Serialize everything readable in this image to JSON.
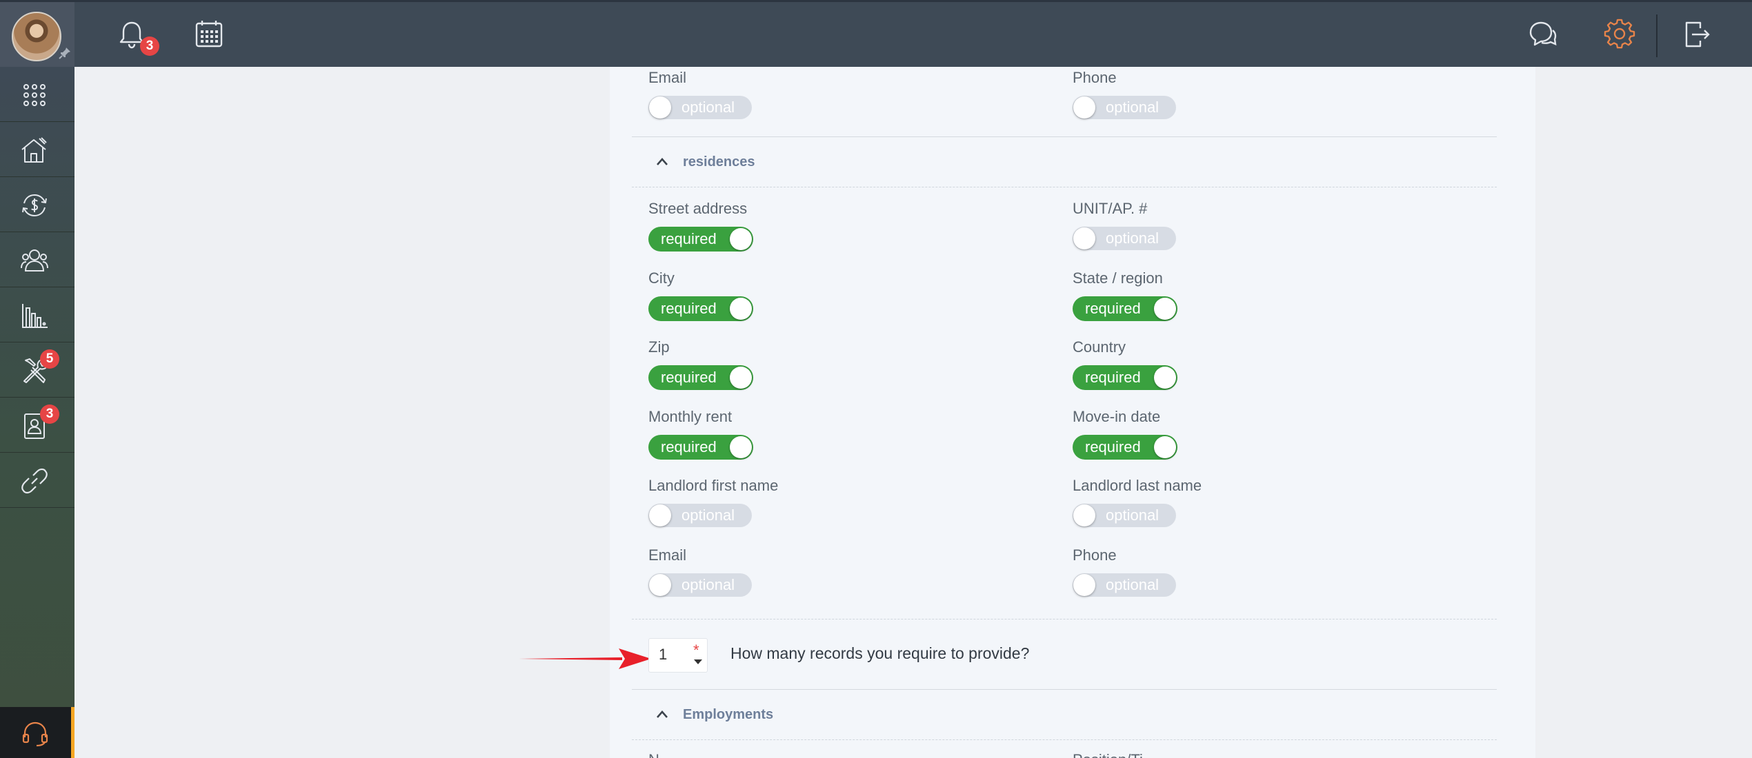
{
  "topbar": {
    "notifications_badge": "3",
    "icons": [
      "bell-icon",
      "calendar-icon",
      "chat-icon",
      "gear-icon",
      "logout-icon"
    ],
    "accent_color": "#e8844a"
  },
  "sidebar": {
    "items": [
      {
        "icon": "apps-grid-icon"
      },
      {
        "icon": "property-house-icon"
      },
      {
        "icon": "money-cycle-icon"
      },
      {
        "icon": "contacts-icon"
      },
      {
        "icon": "reports-chart-icon"
      },
      {
        "icon": "maintenance-tools-icon",
        "badge": "5"
      },
      {
        "icon": "tenant-screening-icon",
        "badge": "3"
      },
      {
        "icon": "link-icon"
      }
    ],
    "support_icon": "headset-icon"
  },
  "applicant_fields": {
    "email": {
      "label": "Email",
      "state": "optional"
    },
    "phone": {
      "label": "Phone",
      "state": "optional"
    }
  },
  "residences": {
    "title": "residences",
    "fields": {
      "street_address": {
        "label": "Street address",
        "state": "required"
      },
      "unit": {
        "label": "UNIT/AP. #",
        "state": "optional"
      },
      "city": {
        "label": "City",
        "state": "required"
      },
      "state_region": {
        "label": "State / region",
        "state": "required"
      },
      "zip": {
        "label": "Zip",
        "state": "required"
      },
      "country": {
        "label": "Country",
        "state": "required"
      },
      "monthly_rent": {
        "label": "Monthly rent",
        "state": "required"
      },
      "move_in_date": {
        "label": "Move-in date",
        "state": "required"
      },
      "landlord_first_name": {
        "label": "Landlord first name",
        "state": "optional"
      },
      "landlord_last_name": {
        "label": "Landlord last name",
        "state": "optional"
      },
      "email": {
        "label": "Email",
        "state": "optional"
      },
      "phone": {
        "label": "Phone",
        "state": "optional"
      }
    },
    "records": {
      "value": "1",
      "required_mark": "*",
      "question": "How many records you require to provide?"
    }
  },
  "employments": {
    "title": "Employments",
    "cut_labels": [
      "N",
      "Position/Ti"
    ]
  },
  "colors": {
    "required": "#3aa13f",
    "optional": "#d7dce4",
    "section_title": "#6e7f9a",
    "arrow": "#e8202a"
  }
}
